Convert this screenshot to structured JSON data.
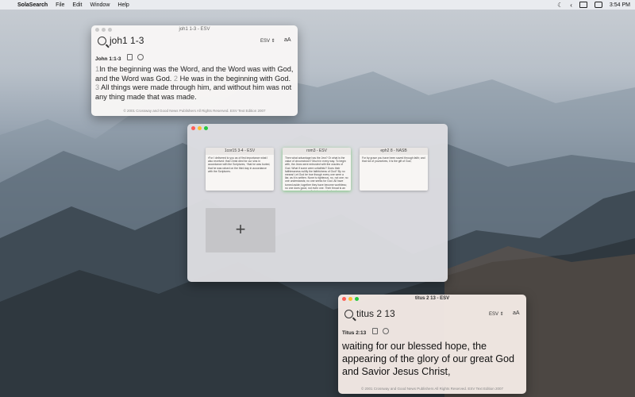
{
  "menubar": {
    "app_name": "SolaSearch",
    "menus": [
      "File",
      "Edit",
      "Window",
      "Help"
    ],
    "time": "3:54 PM"
  },
  "window_john": {
    "title": "joh1 1-3 - ESV",
    "query": "joh1 1-3",
    "version": "ESV ⇕",
    "aa_label": "aA",
    "reference": "John 1:1-3",
    "verses": [
      {
        "num": "1",
        "text": "In the beginning was the Word, and the Word was with God, and the Word was God."
      },
      {
        "num": "2",
        "text": "He was in the beginning with God."
      },
      {
        "num": "3",
        "text": "All things were made through him, and without him was not any thing made that was made."
      }
    ],
    "copyright": "© 2001 Crossway and Good News Publishers All Rights Reserved. ESV Text Edition 2007"
  },
  "workspace": {
    "thumbnails": [
      {
        "title": "1cor15 3-4 - ESV",
        "snippet": "³For I delivered to you as of first importance what I also received: that Christ died for our sins in accordance with the Scriptures, ⁴that he was buried, that he was raised on the third day in accordance with the Scriptures."
      },
      {
        "title": "rom3 - ESV",
        "snippet": "Then what advantage has the Jew? Or what is the value of circumcision? Much in every way. To begin with, the Jews were entrusted with the oracles of God. What if some were unfaithful? Does their faithlessness nullify the faithfulness of God? By no means! Let God be true though every one were a liar, as it is written. None is righteous, no, not one; no one understands; no one seeks for God. All have turned aside; together they have become worthless; no one does good, not even one. Their throat is an open grave; they use their tongues to deceive."
      },
      {
        "title": "eph2 8 - NASB",
        "snippet": "For by grace you have been saved through faith; and that not of yourselves, it is the gift of God;"
      }
    ],
    "add_symbol": "+"
  },
  "window_titus": {
    "title": "titus 2 13 - ESV",
    "query": "titus 2 13",
    "version": "ESV ⇕",
    "aa_label": "aA",
    "reference": "Titus 2:13",
    "text": "waiting for our blessed hope, the appearing of the glory of our great God and Savior Jesus Christ,",
    "copyright": "© 2001 Crossway and Good News Publishers All Rights Reserved. ESV Text Edition 2007"
  }
}
